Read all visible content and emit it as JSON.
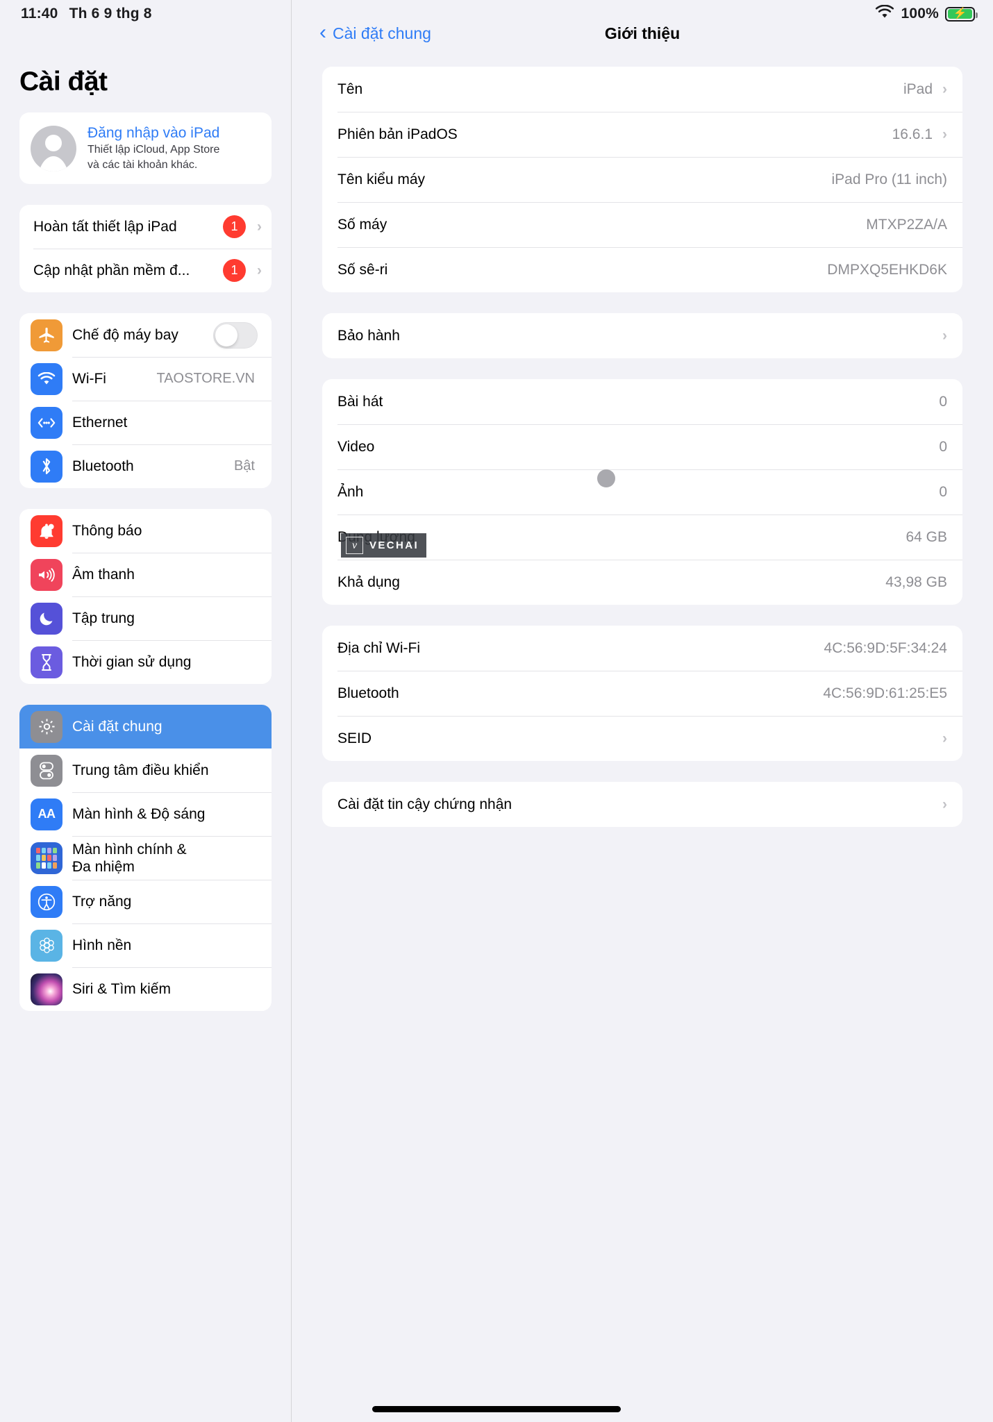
{
  "statusbar": {
    "time": "11:40",
    "date": "Th 6 9 thg 8",
    "battery_pct": "100%",
    "wifi_icon": "wifi-icon",
    "battery_icon": "battery-charging-icon"
  },
  "sidebar": {
    "title": "Cài đặt",
    "signin": {
      "title": "Đăng nhập vào iPad",
      "sub1": "Thiết lập iCloud, App Store",
      "sub2": "và các tài khoản khác."
    },
    "setup_rows": [
      {
        "label": "Hoàn tất thiết lập iPad",
        "badge": "1"
      },
      {
        "label": "Cập nhật phần mềm đ...",
        "badge": "1"
      }
    ],
    "connectivity": [
      {
        "label": "Chế độ máy bay",
        "icon": "airplane-icon",
        "value": "",
        "control": "toggle"
      },
      {
        "label": "Wi-Fi",
        "icon": "wifi-icon",
        "value": "TAOSTORE.VN"
      },
      {
        "label": "Ethernet",
        "icon": "ethernet-icon",
        "value": ""
      },
      {
        "label": "Bluetooth",
        "icon": "bluetooth-icon",
        "value": "Bật"
      }
    ],
    "notifications": [
      {
        "label": "Thông báo",
        "icon": "bell-icon"
      },
      {
        "label": "Âm thanh",
        "icon": "speaker-icon"
      },
      {
        "label": "Tập trung",
        "icon": "moon-icon"
      },
      {
        "label": "Thời gian sử dụng",
        "icon": "hourglass-icon"
      }
    ],
    "general": [
      {
        "label": "Cài đặt chung",
        "icon": "gear-icon",
        "selected": true
      },
      {
        "label": "Trung tâm điều khiển",
        "icon": "control-center-icon"
      },
      {
        "label": "Màn hình & Độ sáng",
        "icon": "display-aa-icon"
      },
      {
        "label": "Màn hình chính &",
        "label2": "Đa nhiệm",
        "icon": "home-screen-icon"
      },
      {
        "label": "Trợ năng",
        "icon": "accessibility-icon"
      },
      {
        "label": "Hình nền",
        "icon": "wallpaper-icon"
      },
      {
        "label": "Siri & Tìm kiếm",
        "icon": "siri-icon"
      }
    ]
  },
  "detail": {
    "back_label": "Cài đặt chung",
    "title": "Giới thiệu",
    "device_rows": [
      {
        "label": "Tên",
        "value": "iPad",
        "chevron": true
      },
      {
        "label": "Phiên bản iPadOS",
        "value": "16.6.1",
        "chevron": true
      },
      {
        "label": "Tên kiểu máy",
        "value": "iPad Pro (11 inch)",
        "chevron": false
      },
      {
        "label": "Số máy",
        "value": "MTXP2ZA/A",
        "chevron": false
      },
      {
        "label": "Số sê-ri",
        "value": "DMPXQ5EHKD6K",
        "chevron": false
      }
    ],
    "warranty_rows": [
      {
        "label": "Bảo hành",
        "value": "",
        "chevron": true
      }
    ],
    "storage_rows": [
      {
        "label": "Bài hát",
        "value": "0",
        "chevron": false
      },
      {
        "label": "Video",
        "value": "0",
        "chevron": false
      },
      {
        "label": "Ảnh",
        "value": "0",
        "chevron": false
      },
      {
        "label": "Dung lượng",
        "value": "64 GB",
        "chevron": false
      },
      {
        "label": "Khả dụng",
        "value": "43,98 GB",
        "chevron": false
      }
    ],
    "network_rows": [
      {
        "label": "Địa chỉ Wi-Fi",
        "value": "4C:56:9D:5F:34:24",
        "chevron": false
      },
      {
        "label": "Bluetooth",
        "value": "4C:56:9D:61:25:E5",
        "chevron": false
      },
      {
        "label": "SEID",
        "value": "",
        "chevron": true
      }
    ],
    "cert_rows": [
      {
        "label": "Cài đặt tin cậy chứng nhận",
        "value": "",
        "chevron": true
      }
    ]
  },
  "watermark": {
    "text": "VECHAI",
    "logo": "v"
  }
}
